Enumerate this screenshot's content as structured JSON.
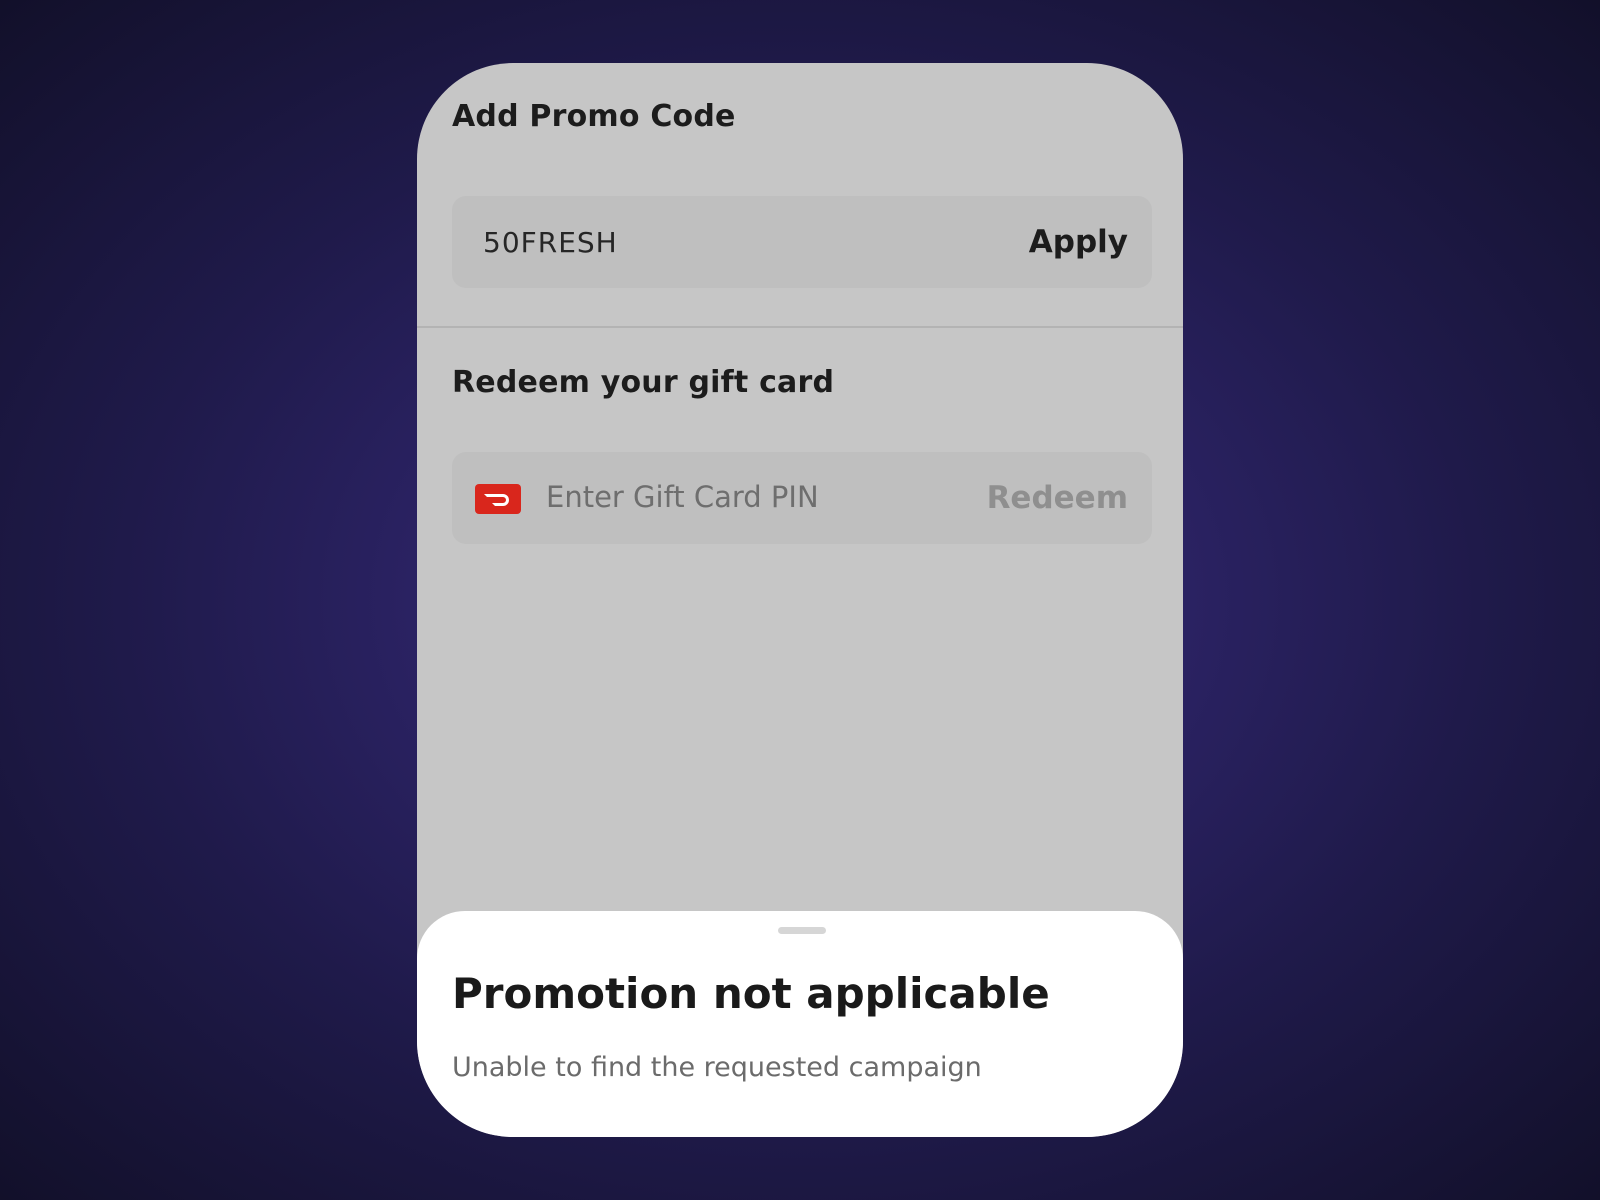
{
  "promo": {
    "title": "Add Promo Code",
    "code_value": "50FRESH",
    "apply_label": "Apply"
  },
  "gift_card": {
    "title": "Redeem your gift card",
    "pin_placeholder": "Enter Gift Card PIN",
    "redeem_label": "Redeem",
    "icon": "doordash-logo-icon",
    "icon_color": "#d9261c"
  },
  "sheet": {
    "title": "Promotion not applicable",
    "message": "Unable to find the requested campaign"
  },
  "colors": {
    "background": "#2c2366",
    "overlay_dim": "#c6c6c6",
    "sheet": "#ffffff"
  }
}
